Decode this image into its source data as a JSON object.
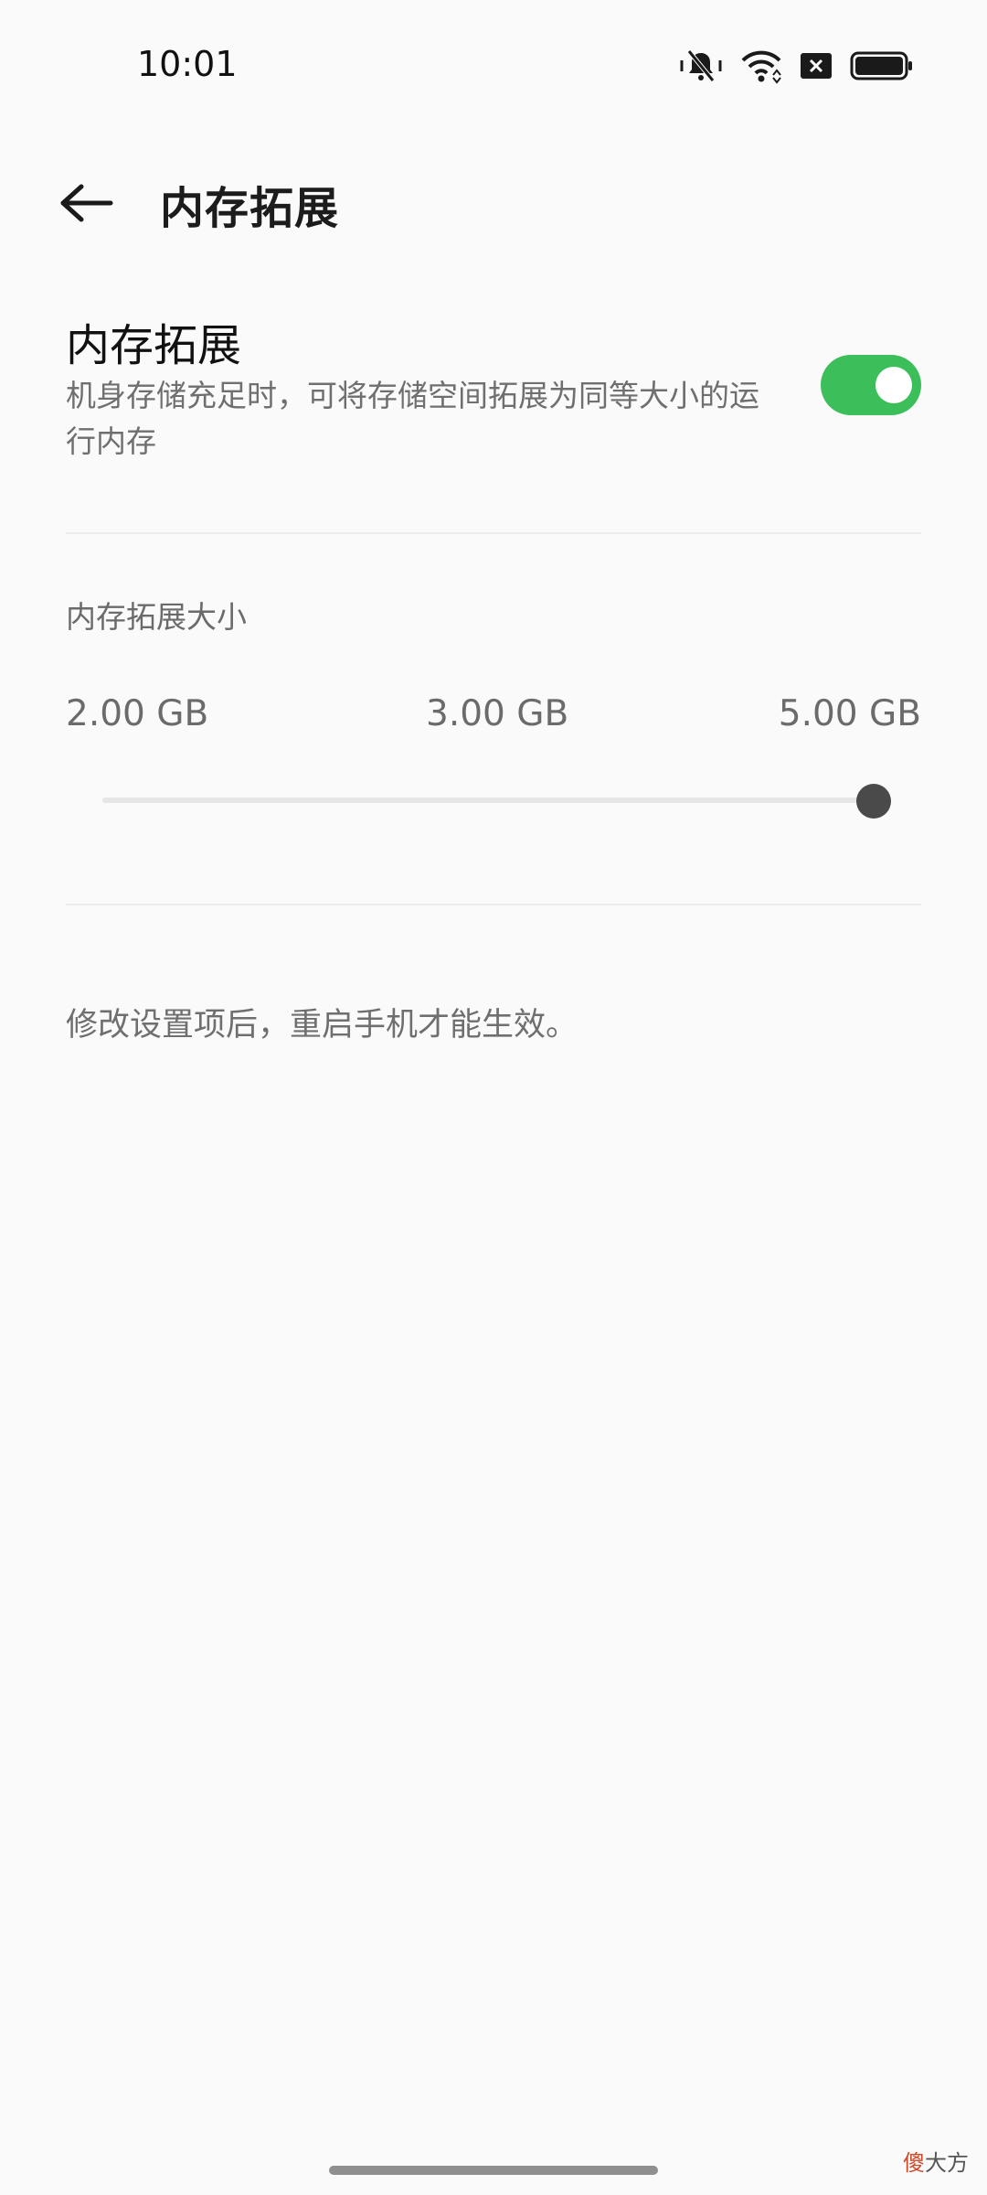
{
  "status_bar": {
    "time": "10:01",
    "icons": [
      "mute-vibrate-icon",
      "wifi-icon",
      "sim-absent-icon",
      "battery-icon"
    ]
  },
  "appbar": {
    "back_icon": "arrow-left-icon",
    "title": "内存拓展"
  },
  "toggle_row": {
    "title": "内存拓展",
    "description": "机身存储充足时，可将存储空间拓展为同等大小的运行内存",
    "enabled": true,
    "accent_color": "#3cbe5a"
  },
  "slider": {
    "label": "内存拓展大小",
    "ticks": [
      "2.00 GB",
      "3.00 GB",
      "5.00 GB"
    ],
    "selected_index": 2,
    "selected_value": "5.00 GB"
  },
  "note": "修改设置项后，重启手机才能生效。",
  "watermark": {
    "first": "傻",
    "rest": "大方"
  }
}
